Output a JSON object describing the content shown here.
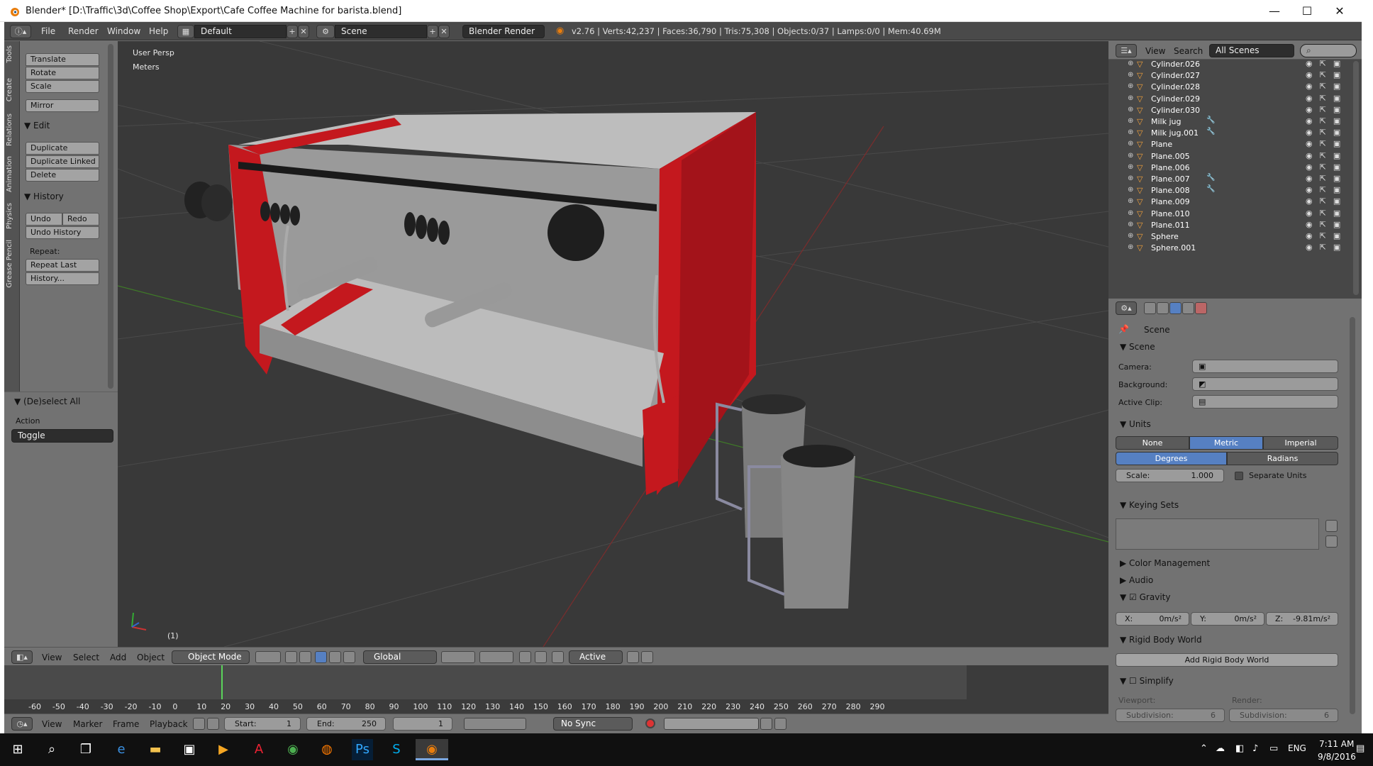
{
  "window": {
    "title": "Blender* [D:\\Traffic\\3d\\Coffee Shop\\Export\\Cafe Coffee Machine for barista.blend]",
    "controls": [
      "—",
      "☐",
      "✕"
    ]
  },
  "info_header": {
    "menus": [
      "File",
      "Render",
      "Window",
      "Help"
    ],
    "layout": "Default",
    "scene": "Scene",
    "engine": "Blender Render",
    "stats": "v2.76 | Verts:42,237 | Faces:36,790 | Tris:75,308 | Objects:0/37 | Lamps:0/0 | Mem:40.69M"
  },
  "tool_tabs": [
    "Tools",
    "Create",
    "Relations",
    "Animation",
    "Physics",
    "Grease Pencil"
  ],
  "tool_shelf": {
    "transform_buttons": [
      "Translate",
      "Rotate",
      "Scale"
    ],
    "mirror": "Mirror",
    "edit_header": "Edit",
    "edit_buttons": [
      "Duplicate",
      "Duplicate Linked",
      "Delete"
    ],
    "history_header": "History",
    "undo": "Undo",
    "redo": "Redo",
    "undo_history": "Undo History",
    "repeat_label": "Repeat:",
    "repeat_last": "Repeat Last",
    "history_btn": "History..."
  },
  "operator_panel": {
    "header": "(De)select All",
    "action_label": "Action",
    "action_value": "Toggle"
  },
  "viewport": {
    "view_name": "User Persp",
    "units": "Meters",
    "frame_indicator": "(1)"
  },
  "viewport_header": {
    "menus": [
      "View",
      "Select",
      "Add",
      "Object"
    ],
    "mode": "Object Mode",
    "orientation": "Global",
    "pivot_active": "Active"
  },
  "timeline": {
    "ticks": [
      "-60",
      "-50",
      "-40",
      "-30",
      "-20",
      "-10",
      "0",
      "10",
      "20",
      "30",
      "40",
      "50",
      "60",
      "70",
      "80",
      "90",
      "100",
      "110",
      "120",
      "130",
      "140",
      "150",
      "160",
      "170",
      "180",
      "190",
      "200",
      "210",
      "220",
      "230",
      "240",
      "250",
      "260",
      "270",
      "280",
      "290"
    ],
    "menus": [
      "View",
      "Marker",
      "Frame",
      "Playback"
    ],
    "start_label": "Start:",
    "start_value": "1",
    "end_label": "End:",
    "end_value": "250",
    "current_frame": "1",
    "sync": "No Sync"
  },
  "outliner": {
    "menus": [
      "View",
      "Search"
    ],
    "filter": "All Scenes",
    "rows": [
      "Cylinder.026",
      "Cylinder.027",
      "Cylinder.028",
      "Cylinder.029",
      "Cylinder.030",
      "Milk jug",
      "Milk jug.001",
      "Plane",
      "Plane.005",
      "Plane.006",
      "Plane.007",
      "Plane.008",
      "Plane.009",
      "Plane.010",
      "Plane.011",
      "Sphere",
      "Sphere.001"
    ]
  },
  "properties": {
    "context": "Scene",
    "scene_panel": "Scene",
    "camera_label": "Camera:",
    "background_label": "Background:",
    "active_clip_label": "Active Clip:",
    "units_panel": "Units",
    "unit_systems": [
      "None",
      "Metric",
      "Imperial"
    ],
    "unit_selected": "Metric",
    "rotation_units": [
      "Degrees",
      "Radians"
    ],
    "scale_label": "Scale:",
    "scale_value": "1.000",
    "separate_units": "Separate Units",
    "keying_sets": "Keying Sets",
    "color_management": "Color Management",
    "audio": "Audio",
    "gravity": "Gravity",
    "gravity_x": "X:",
    "gravity_x_val": "0m/s²",
    "gravity_y": "Y:",
    "gravity_y_val": "0m/s²",
    "gravity_z": "Z:",
    "gravity_z_val": "-9.81m/s²",
    "rigid_body_world": "Rigid Body World",
    "add_rigid_body_world": "Add Rigid Body World",
    "simplify": "Simplify",
    "viewport_label": "Viewport:",
    "render_label": "Render:",
    "subdivision_label": "Subdivision:",
    "subdivision_value": "6"
  },
  "taskbar": {
    "time": "7:11 AM",
    "date": "9/8/2016",
    "lang": "ENG"
  },
  "colors": {
    "accent_blue": "#5680c2",
    "machine_red": "#c4181e",
    "viewport_bg": "#393939"
  }
}
